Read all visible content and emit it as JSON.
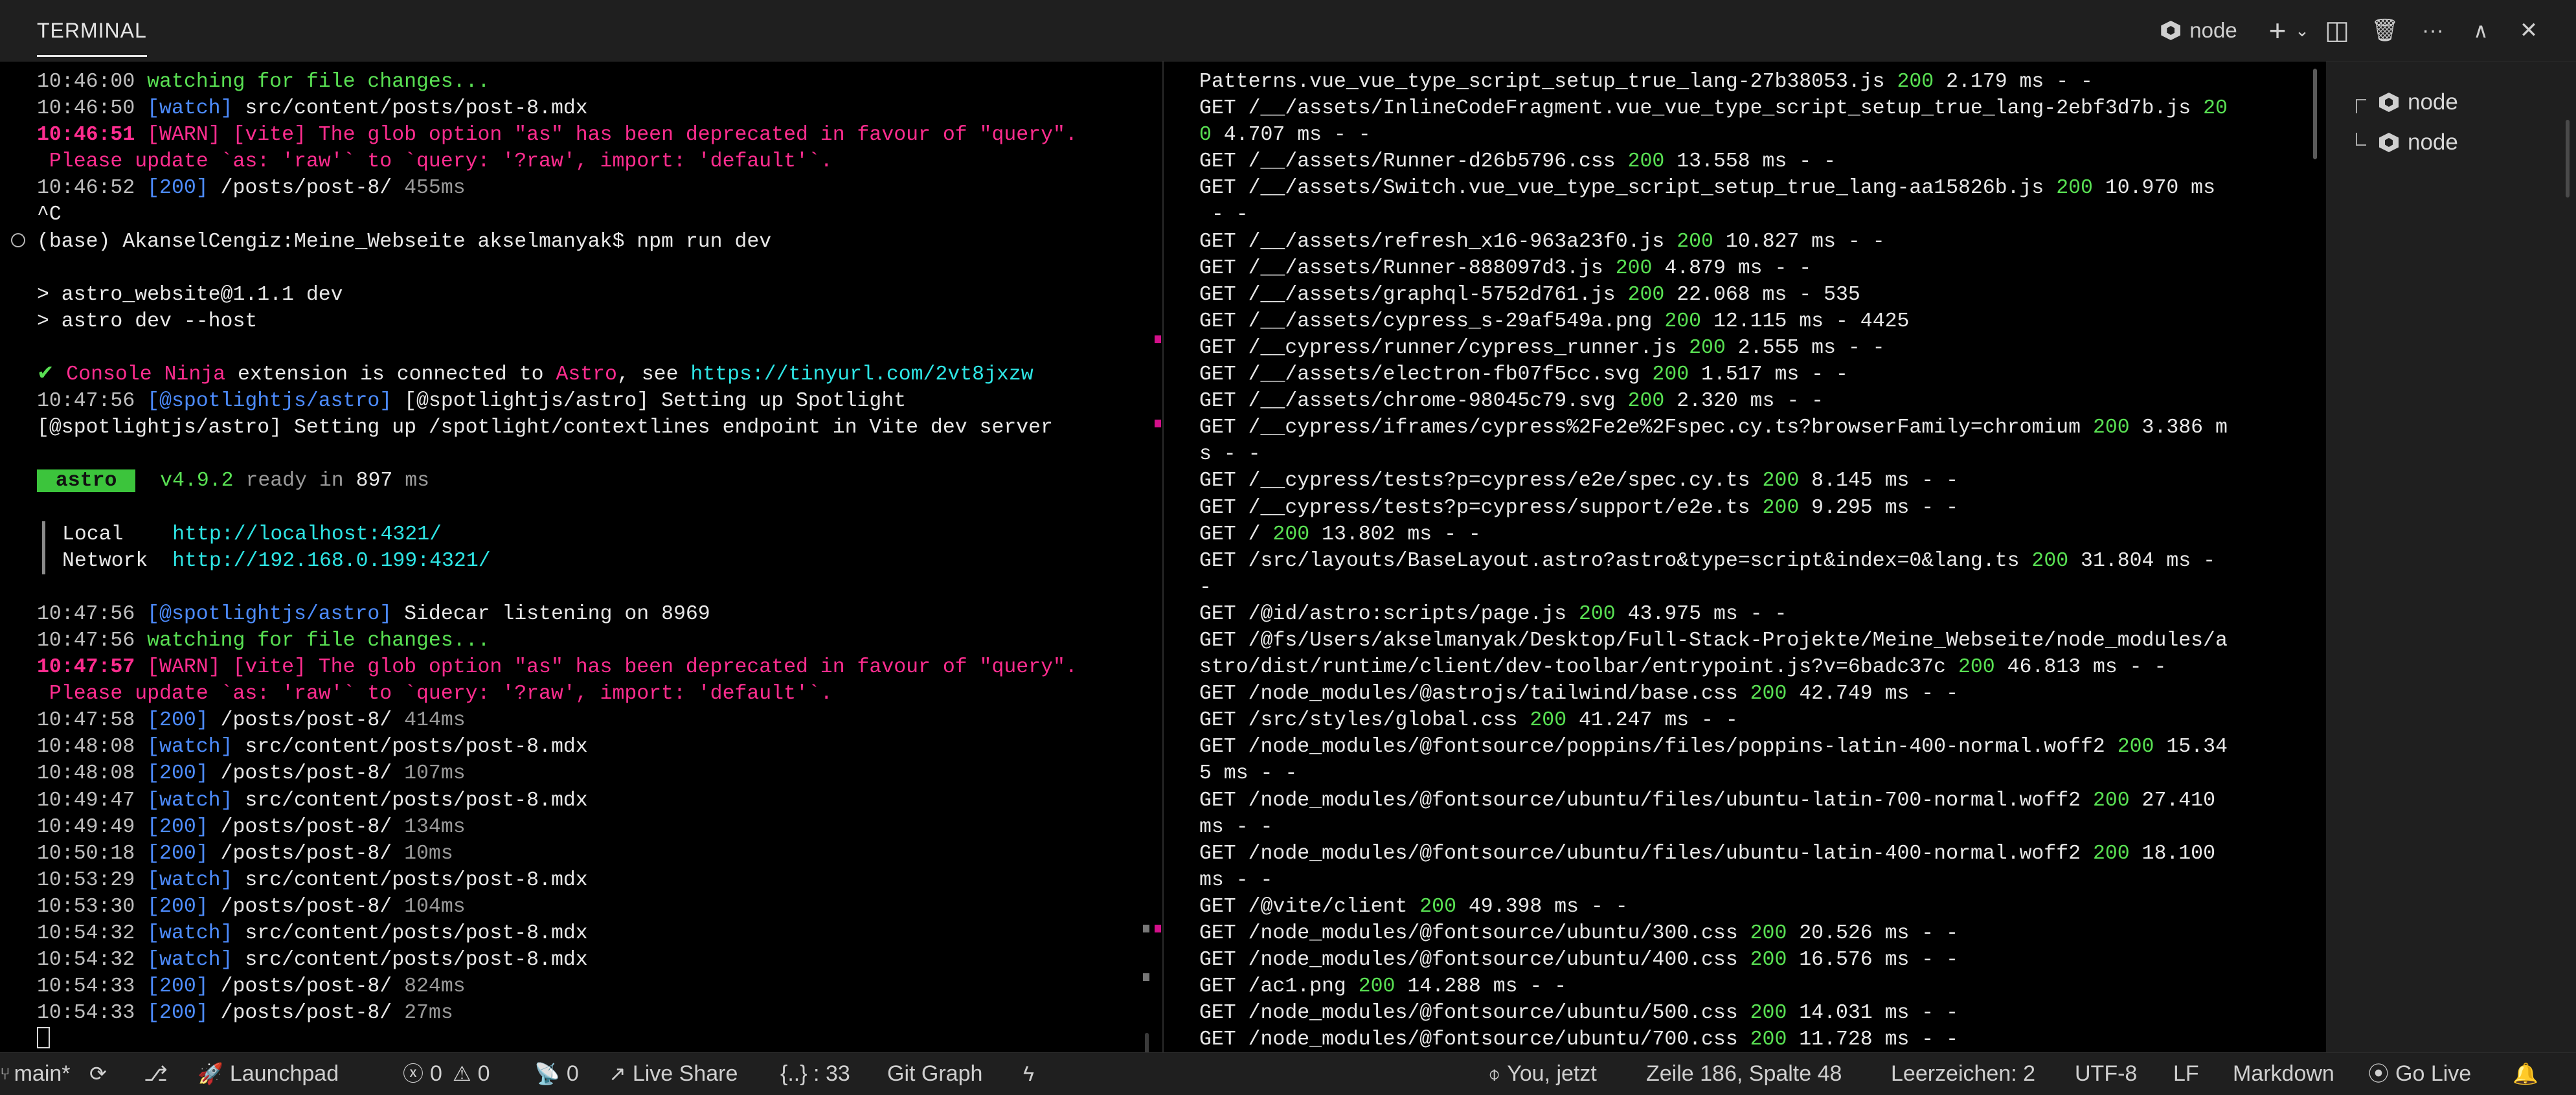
{
  "panel": {
    "tab_label": "TERMINAL",
    "terminal_name": "node",
    "actions": {
      "add": "+",
      "chevron": "⌄",
      "split": "◫",
      "delete": "🗑",
      "more": "···",
      "maximize": "∧",
      "close": "✕"
    }
  },
  "left_terminal": {
    "lines": [
      [
        {
          "t": "10:46:00 ",
          "c": "dim"
        },
        {
          "t": "watching for file changes...",
          "c": "green"
        }
      ],
      [
        {
          "t": "10:46:50 ",
          "c": "dim"
        },
        {
          "t": "[watch]",
          "c": "blue"
        },
        {
          "t": " src/content/posts/post-8.mdx"
        }
      ],
      [
        {
          "t": "10:46:51 ",
          "c": "magenta",
          "b": true
        },
        {
          "t": "[WARN] [vite] The glob option \"as\" has been deprecated in favour of \"query\".",
          "c": "magenta"
        }
      ],
      [
        {
          "t": " Please update `as: 'raw'` to `query: '?raw', import: 'default'`.",
          "c": "magenta"
        }
      ],
      [
        {
          "t": "10:46:52 ",
          "c": "dim"
        },
        {
          "t": "[200]",
          "c": "blue"
        },
        {
          "t": " /posts/post-8/ "
        },
        {
          "t": "455ms",
          "c": "gray"
        }
      ],
      [
        {
          "t": "^C"
        }
      ],
      [
        {
          "t": "(base) AkanselCengiz:Meine_Webseite akselmanyak$ npm run dev",
          "prompt": true
        }
      ],
      [
        {
          "t": ""
        }
      ],
      [
        {
          "t": "> astro_website@1.1.1 dev"
        }
      ],
      [
        {
          "t": "> astro dev --host"
        }
      ],
      [
        {
          "t": ""
        }
      ],
      [
        {
          "t": "✔ ",
          "c": "green"
        },
        {
          "t": "Console Ninja",
          "c": "magenta"
        },
        {
          "t": " extension is connected to "
        },
        {
          "t": "Astro",
          "c": "magenta"
        },
        {
          "t": ", see "
        },
        {
          "t": "https://tinyurl.com/2vt8jxzw",
          "c": "cyan"
        }
      ],
      [
        {
          "t": "10:47:56 ",
          "c": "dim"
        },
        {
          "t": "[@spotlightjs/astro]",
          "c": "blue"
        },
        {
          "t": " [@spotlightjs/astro] Setting up Spotlight"
        }
      ],
      [
        {
          "t": "[@spotlightjs/astro] Setting up /spotlight/contextlines endpoint in Vite dev server"
        }
      ],
      [
        {
          "t": ""
        }
      ],
      [
        {
          "t": " astro ",
          "badge": true
        },
        {
          "t": "  v4.9.2 ",
          "c": "green"
        },
        {
          "t": "ready in ",
          "c": "gray"
        },
        {
          "t": "897 "
        },
        {
          "t": "ms",
          "c": "gray"
        }
      ],
      [
        {
          "t": ""
        }
      ],
      [
        {
          "t": "Local    ",
          "box": true
        },
        {
          "t": "http://localhost:4321/",
          "c": "cyan"
        }
      ],
      [
        {
          "t": "Network  ",
          "box": true
        },
        {
          "t": "http://192.168.0.199:4321/",
          "c": "cyan"
        }
      ],
      [
        {
          "t": ""
        }
      ],
      [
        {
          "t": "10:47:56 ",
          "c": "dim"
        },
        {
          "t": "[@spotlightjs/astro]",
          "c": "blue"
        },
        {
          "t": " Sidecar listening on 8969"
        }
      ],
      [
        {
          "t": "10:47:56 ",
          "c": "dim"
        },
        {
          "t": "watching for file changes...",
          "c": "green"
        }
      ],
      [
        {
          "t": "10:47:57 ",
          "c": "magenta",
          "b": true
        },
        {
          "t": "[WARN] [vite] The glob option \"as\" has been deprecated in favour of \"query\".",
          "c": "magenta"
        }
      ],
      [
        {
          "t": " Please update `as: 'raw'` to `query: '?raw', import: 'default'`.",
          "c": "magenta"
        }
      ],
      [
        {
          "t": "10:47:58 ",
          "c": "dim"
        },
        {
          "t": "[200]",
          "c": "blue"
        },
        {
          "t": " /posts/post-8/ "
        },
        {
          "t": "414ms",
          "c": "gray"
        }
      ],
      [
        {
          "t": "10:48:08 ",
          "c": "dim"
        },
        {
          "t": "[watch]",
          "c": "blue"
        },
        {
          "t": " src/content/posts/post-8.mdx"
        }
      ],
      [
        {
          "t": "10:48:08 ",
          "c": "dim"
        },
        {
          "t": "[200]",
          "c": "blue"
        },
        {
          "t": " /posts/post-8/ "
        },
        {
          "t": "107ms",
          "c": "gray"
        }
      ],
      [
        {
          "t": "10:49:47 ",
          "c": "dim"
        },
        {
          "t": "[watch]",
          "c": "blue"
        },
        {
          "t": " src/content/posts/post-8.mdx"
        }
      ],
      [
        {
          "t": "10:49:49 ",
          "c": "dim"
        },
        {
          "t": "[200]",
          "c": "blue"
        },
        {
          "t": " /posts/post-8/ "
        },
        {
          "t": "134ms",
          "c": "gray"
        }
      ],
      [
        {
          "t": "10:50:18 ",
          "c": "dim"
        },
        {
          "t": "[200]",
          "c": "blue"
        },
        {
          "t": " /posts/post-8/ "
        },
        {
          "t": "10ms",
          "c": "gray"
        }
      ],
      [
        {
          "t": "10:53:29 ",
          "c": "dim"
        },
        {
          "t": "[watch]",
          "c": "blue"
        },
        {
          "t": " src/content/posts/post-8.mdx"
        }
      ],
      [
        {
          "t": "10:53:30 ",
          "c": "dim"
        },
        {
          "t": "[200]",
          "c": "blue"
        },
        {
          "t": " /posts/post-8/ "
        },
        {
          "t": "104ms",
          "c": "gray"
        }
      ],
      [
        {
          "t": "10:54:32 ",
          "c": "dim"
        },
        {
          "t": "[watch]",
          "c": "blue"
        },
        {
          "t": " src/content/posts/post-8.mdx"
        }
      ],
      [
        {
          "t": "10:54:32 ",
          "c": "dim"
        },
        {
          "t": "[watch]",
          "c": "blue"
        },
        {
          "t": " src/content/posts/post-8.mdx"
        }
      ],
      [
        {
          "t": "10:54:33 ",
          "c": "dim"
        },
        {
          "t": "[200]",
          "c": "blue"
        },
        {
          "t": " /posts/post-8/ "
        },
        {
          "t": "824ms",
          "c": "gray"
        }
      ],
      [
        {
          "t": "10:54:33 ",
          "c": "dim"
        },
        {
          "t": "[200]",
          "c": "blue"
        },
        {
          "t": " /posts/post-8/ "
        },
        {
          "t": "27ms",
          "c": "gray"
        }
      ],
      [
        {
          "t": "",
          "cursor": true
        }
      ]
    ]
  },
  "right_terminal": {
    "lines": [
      [
        {
          "t": "Patterns.vue_vue_type_script_setup_true_lang-27b38053.js "
        },
        {
          "t": "200",
          "c": "green"
        },
        {
          "t": " 2.179 ms - -"
        }
      ],
      [
        {
          "t": "GET /__/assets/InlineCodeFragment.vue_vue_type_script_setup_true_lang-2ebf3d7b.js "
        },
        {
          "t": "20",
          "c": "green"
        }
      ],
      [
        {
          "t": "0",
          "c": "green"
        },
        {
          "t": " 4.707 ms - -"
        }
      ],
      [
        {
          "t": "GET /__/assets/Runner-d26b5796.css "
        },
        {
          "t": "200",
          "c": "green"
        },
        {
          "t": " 13.558 ms - -"
        }
      ],
      [
        {
          "t": "GET /__/assets/Switch.vue_vue_type_script_setup_true_lang-aa15826b.js "
        },
        {
          "t": "200",
          "c": "green"
        },
        {
          "t": " 10.970 ms"
        }
      ],
      [
        {
          "t": " - -"
        }
      ],
      [
        {
          "t": "GET /__/assets/refresh_x16-963a23f0.js "
        },
        {
          "t": "200",
          "c": "green"
        },
        {
          "t": " 10.827 ms - -"
        }
      ],
      [
        {
          "t": "GET /__/assets/Runner-888097d3.js "
        },
        {
          "t": "200",
          "c": "green"
        },
        {
          "t": " 4.879 ms - -"
        }
      ],
      [
        {
          "t": "GET /__/assets/graphql-5752d761.js "
        },
        {
          "t": "200",
          "c": "green"
        },
        {
          "t": " 22.068 ms - 535"
        }
      ],
      [
        {
          "t": "GET /__/assets/cypress_s-29af549a.png "
        },
        {
          "t": "200",
          "c": "green"
        },
        {
          "t": " 12.115 ms - 4425"
        }
      ],
      [
        {
          "t": "GET /__cypress/runner/cypress_runner.js "
        },
        {
          "t": "200",
          "c": "green"
        },
        {
          "t": " 2.555 ms - -"
        }
      ],
      [
        {
          "t": "GET /__/assets/electron-fb07f5cc.svg "
        },
        {
          "t": "200",
          "c": "green"
        },
        {
          "t": " 1.517 ms - -"
        }
      ],
      [
        {
          "t": "GET /__/assets/chrome-98045c79.svg "
        },
        {
          "t": "200",
          "c": "green"
        },
        {
          "t": " 2.320 ms - -"
        }
      ],
      [
        {
          "t": "GET /__cypress/iframes/cypress%2Fe2e%2Fspec.cy.ts?browserFamily=chromium "
        },
        {
          "t": "200",
          "c": "green"
        },
        {
          "t": " 3.386 m"
        }
      ],
      [
        {
          "t": "s - -"
        }
      ],
      [
        {
          "t": "GET /__cypress/tests?p=cypress/e2e/spec.cy.ts "
        },
        {
          "t": "200",
          "c": "green"
        },
        {
          "t": " 8.145 ms - -"
        }
      ],
      [
        {
          "t": "GET /__cypress/tests?p=cypress/support/e2e.ts "
        },
        {
          "t": "200",
          "c": "green"
        },
        {
          "t": " 9.295 ms - -"
        }
      ],
      [
        {
          "t": "GET / "
        },
        {
          "t": "200",
          "c": "green"
        },
        {
          "t": " 13.802 ms - -"
        }
      ],
      [
        {
          "t": "GET /src/layouts/BaseLayout.astro?astro&type=script&index=0&lang.ts "
        },
        {
          "t": "200",
          "c": "green"
        },
        {
          "t": " 31.804 ms -"
        }
      ],
      [
        {
          "t": "-"
        }
      ],
      [
        {
          "t": "GET /@id/astro:scripts/page.js "
        },
        {
          "t": "200",
          "c": "green"
        },
        {
          "t": " 43.975 ms - -"
        }
      ],
      [
        {
          "t": "GET /@fs/Users/akselmanyak/Desktop/Full-Stack-Projekte/Meine_Webseite/node_modules/a"
        }
      ],
      [
        {
          "t": "stro/dist/runtime/client/dev-toolbar/entrypoint.js?v=6badc37c "
        },
        {
          "t": "200",
          "c": "green"
        },
        {
          "t": " 46.813 ms - -"
        }
      ],
      [
        {
          "t": "GET /node_modules/@astrojs/tailwind/base.css "
        },
        {
          "t": "200",
          "c": "green"
        },
        {
          "t": " 42.749 ms - -"
        }
      ],
      [
        {
          "t": "GET /src/styles/global.css "
        },
        {
          "t": "200",
          "c": "green"
        },
        {
          "t": " 41.247 ms - -"
        }
      ],
      [
        {
          "t": "GET /node_modules/@fontsource/poppins/files/poppins-latin-400-normal.woff2 "
        },
        {
          "t": "200",
          "c": "green"
        },
        {
          "t": " 15.34"
        }
      ],
      [
        {
          "t": "5 ms - -"
        }
      ],
      [
        {
          "t": "GET /node_modules/@fontsource/ubuntu/files/ubuntu-latin-700-normal.woff2 "
        },
        {
          "t": "200",
          "c": "green"
        },
        {
          "t": " 27.410"
        }
      ],
      [
        {
          "t": "ms - -"
        }
      ],
      [
        {
          "t": "GET /node_modules/@fontsource/ubuntu/files/ubuntu-latin-400-normal.woff2 "
        },
        {
          "t": "200",
          "c": "green"
        },
        {
          "t": " 18.100"
        }
      ],
      [
        {
          "t": "ms - -"
        }
      ],
      [
        {
          "t": "GET /@vite/client "
        },
        {
          "t": "200",
          "c": "green"
        },
        {
          "t": " 49.398 ms - -"
        }
      ],
      [
        {
          "t": "GET /node_modules/@fontsource/ubuntu/300.css "
        },
        {
          "t": "200",
          "c": "green"
        },
        {
          "t": " 20.526 ms - -"
        }
      ],
      [
        {
          "t": "GET /node_modules/@fontsource/ubuntu/400.css "
        },
        {
          "t": "200",
          "c": "green"
        },
        {
          "t": " 16.576 ms - -"
        }
      ],
      [
        {
          "t": "GET /ac1.png "
        },
        {
          "t": "200",
          "c": "green"
        },
        {
          "t": " 14.288 ms - -"
        }
      ],
      [
        {
          "t": "GET /node_modules/@fontsource/ubuntu/500.css "
        },
        {
          "t": "200",
          "c": "green"
        },
        {
          "t": " 14.031 ms - -"
        }
      ],
      [
        {
          "t": "GET /node_modules/@fontsource/ubuntu/700.css "
        },
        {
          "t": "200",
          "c": "green"
        },
        {
          "t": " 11.728 ms - -"
        }
      ]
    ]
  },
  "terminal_list": {
    "items": [
      {
        "label": "node"
      },
      {
        "label": "node"
      }
    ]
  },
  "statusbar": {
    "branch": "main*",
    "launchpad": "Launchpad",
    "errors": "0",
    "warnings": "0",
    "ports": "0",
    "live_share": "Live Share",
    "scope": "{..} : 33",
    "git_graph": "Git Graph",
    "blame": "You, jetzt",
    "position": "Zeile 186, Spalte 48",
    "spaces": "Leerzeichen: 2",
    "encoding": "UTF-8",
    "eol": "LF",
    "language": "Markdown",
    "go_live": "Go Live"
  },
  "colors": {
    "green": "#59e053",
    "blue": "#4d8cff",
    "magenta": "#ff2d8f",
    "cyan": "#2ee6e6",
    "gray": "#9a9a9a",
    "badge": "#3cc43c"
  }
}
